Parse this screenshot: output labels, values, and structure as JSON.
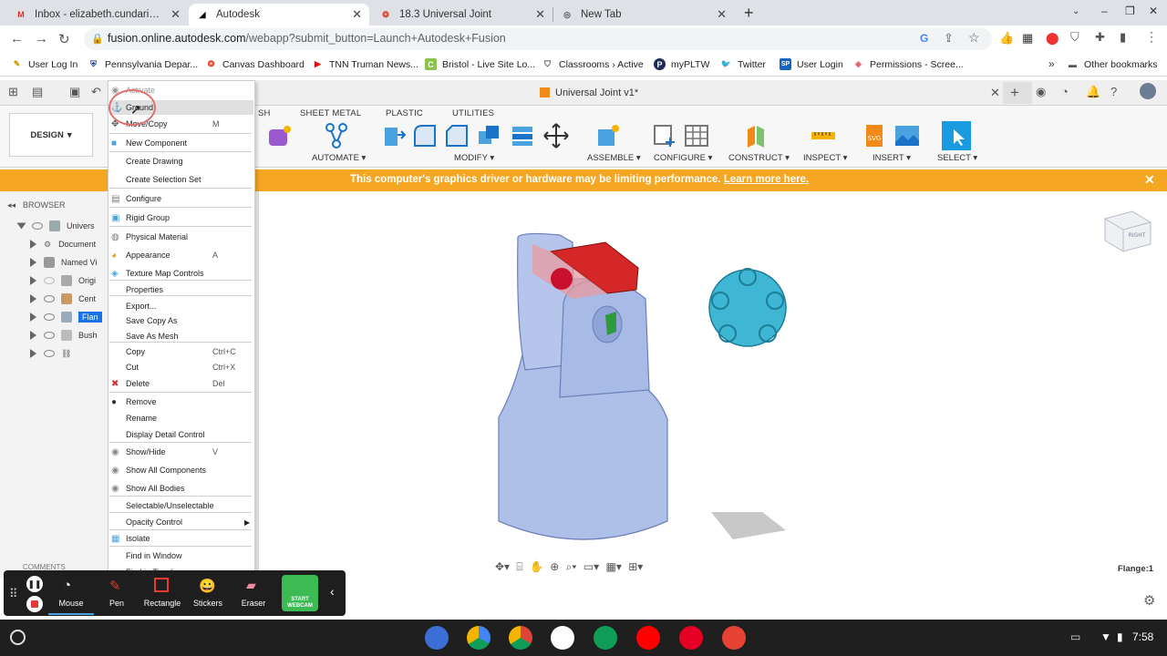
{
  "browser": {
    "tabs": [
      {
        "title": "Inbox - elizabeth.cundari@bristol",
        "favicon": "gmail-icon"
      },
      {
        "title": "Autodesk",
        "favicon": "autodesk-icon",
        "active": true
      },
      {
        "title": "18.3 Universal Joint",
        "favicon": "canvas-icon"
      },
      {
        "title": "New Tab",
        "favicon": "chrome-icon"
      }
    ],
    "url_domain": "fusion.online.autodesk.com",
    "url_path": "/webapp?submit_button=Launch+Autodesk+Fusion",
    "bookmarks": [
      "User Log In",
      "Pennsylvania Depar...",
      "Canvas Dashboard",
      "TNN Truman News...",
      "Bristol - Live Site Lo...",
      "Classrooms › Active",
      "myPLTW",
      "Twitter",
      "User Login",
      "Permissions - Scree..."
    ],
    "other_bookmarks": "Other bookmarks"
  },
  "fusion": {
    "document_title": "Universal Joint v1*",
    "workspace": "DESIGN",
    "ribbon_tabs": [
      "SH",
      "SHEET METAL",
      "PLASTIC",
      "UTILITIES"
    ],
    "groups": [
      "AUTOMATE",
      "MODIFY",
      "ASSEMBLE",
      "CONFIGURE",
      "CONSTRUCT",
      "INSPECT",
      "INSERT",
      "SELECT"
    ],
    "warning": "This computer's graphics driver or hardware may be limiting performance.",
    "warning_link": "Learn more here.",
    "browser_label": "BROWSER",
    "browser_items": [
      "Univers",
      "Document",
      "Named Vi",
      "Origi",
      "Cent",
      "Flan",
      "Bush",
      ""
    ],
    "comments_label": "COMMENTS",
    "status_label": "Flange:1",
    "viewcube_face": "RIGHT"
  },
  "context_menu": [
    {
      "label": "Activate",
      "shortcut": "",
      "disabled": true
    },
    {
      "label": "Ground",
      "shortcut": ""
    },
    {
      "label": "Move/Copy",
      "shortcut": "M"
    },
    {
      "label": "New Component",
      "shortcut": ""
    },
    {
      "label": "Create Drawing",
      "shortcut": ""
    },
    {
      "label": "Create Selection Set",
      "shortcut": ""
    },
    {
      "label": "Configure",
      "shortcut": ""
    },
    {
      "label": "Rigid Group",
      "shortcut": ""
    },
    {
      "label": "Physical Material",
      "shortcut": ""
    },
    {
      "label": "Appearance",
      "shortcut": "A"
    },
    {
      "label": "Texture Map Controls",
      "shortcut": ""
    },
    {
      "label": "Properties",
      "shortcut": ""
    },
    {
      "label": "Export...",
      "shortcut": ""
    },
    {
      "label": "Save Copy As",
      "shortcut": ""
    },
    {
      "label": "Save As Mesh",
      "shortcut": ""
    },
    {
      "label": "Copy",
      "shortcut": "Ctrl+C"
    },
    {
      "label": "Cut",
      "shortcut": "Ctrl+X"
    },
    {
      "label": "Delete",
      "shortcut": "Del"
    },
    {
      "label": "Remove",
      "shortcut": ""
    },
    {
      "label": "Rename",
      "shortcut": ""
    },
    {
      "label": "Display Detail Control",
      "shortcut": ""
    },
    {
      "label": "Show/Hide",
      "shortcut": "V"
    },
    {
      "label": "Show All Components",
      "shortcut": ""
    },
    {
      "label": "Show All Bodies",
      "shortcut": ""
    },
    {
      "label": "Selectable/Unselectable",
      "shortcut": ""
    },
    {
      "label": "Opacity Control",
      "shortcut": ""
    },
    {
      "label": "Isolate",
      "shortcut": ""
    },
    {
      "label": "Find in Window",
      "shortcut": ""
    },
    {
      "label": "Find in Timeline",
      "shortcut": ""
    }
  ],
  "screencast": {
    "tools": [
      "Mouse",
      "Pen",
      "Rectangle",
      "Stickers",
      "Eraser"
    ],
    "webcam": "START WEBCAM"
  },
  "shelf": {
    "time": "7:58"
  },
  "colors": {
    "warning": "#f5a623",
    "selection": "#1a73e8",
    "model": "#aebfe8",
    "flange": "#3fb6d4"
  }
}
